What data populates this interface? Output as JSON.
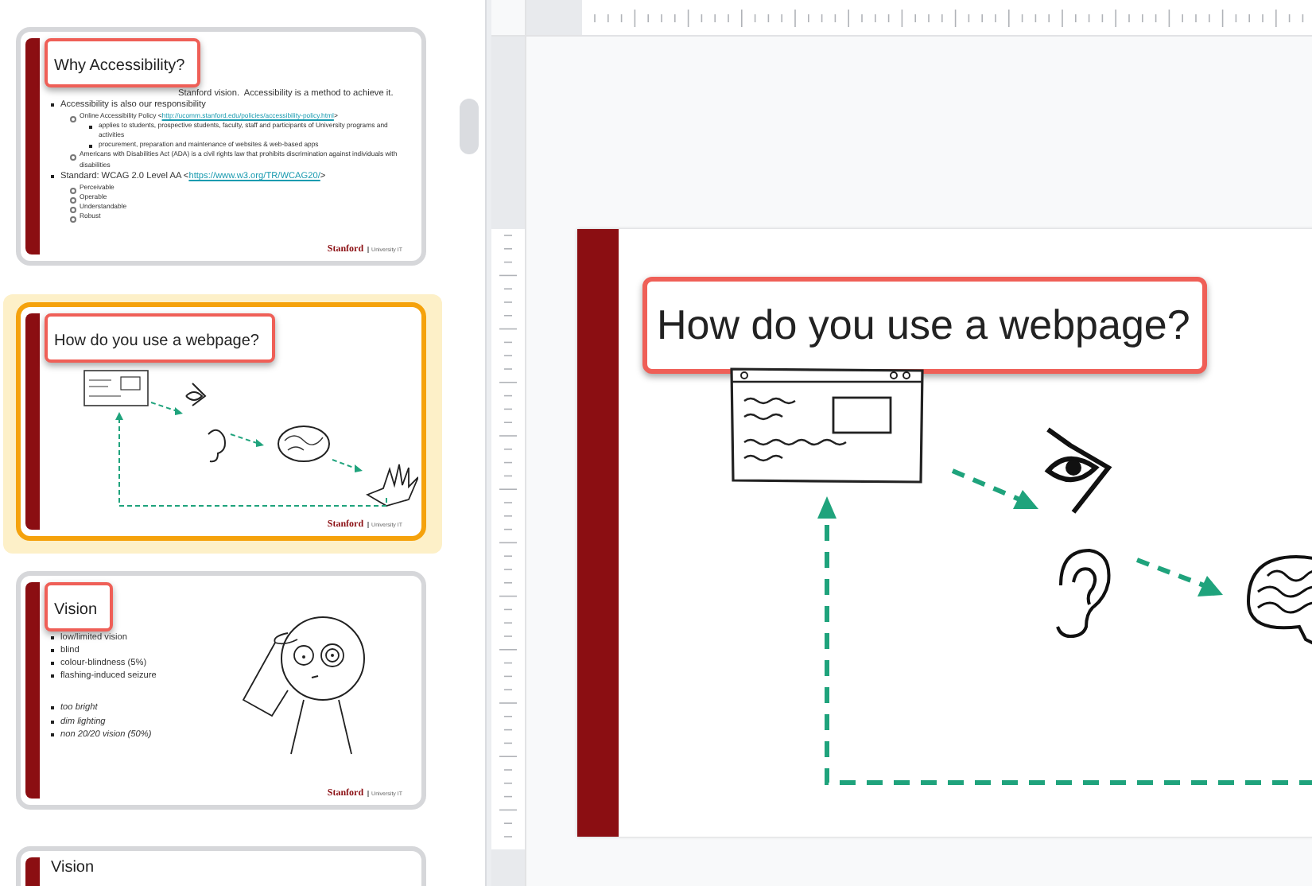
{
  "slides": [
    {
      "title": "Why Accessibility?",
      "selected": false,
      "highlighted": true,
      "lead": "Stanford vision.  Accessibility is a method to achieve it.",
      "bullets": [
        {
          "text": "Accessibility is also our responsibility",
          "children": [
            {
              "text": "Online Accessibility Policy <",
              "link": "http://ucomm.stanford.edu/policies/accessibility-policy.html",
              "after": ">",
              "children": [
                {
                  "text": "applies to students, prospective students, faculty, staff and participants of University programs and activities"
                },
                {
                  "text": "procurement, preparation and maintenance of websites & web-based apps"
                }
              ]
            },
            {
              "text": "Americans with Disabilities Act (ADA) is a civil rights law that prohibits discrimination against individuals with disabilities"
            }
          ]
        },
        {
          "text": "Standard: WCAG 2.0 Level AA <",
          "link": "https://www.w3.org/TR/WCAG20/",
          "after": ">",
          "children": [
            {
              "text": "Perceivable"
            },
            {
              "text": "Operable"
            },
            {
              "text": "Understandable"
            },
            {
              "text": "Robust"
            }
          ]
        }
      ],
      "footer": {
        "brand": "Stanford",
        "unit": "University IT"
      }
    },
    {
      "title": "How do you use a webpage?",
      "selected": true,
      "highlighted": true,
      "kind": "flow",
      "footer": {
        "brand": "Stanford",
        "unit": "University IT"
      }
    },
    {
      "title": "Vision",
      "selected": false,
      "highlighted": true,
      "kind": "person",
      "bullets": [
        {
          "text": "low/limited vision",
          "kind": "item"
        },
        {
          "text": "blind",
          "kind": "item"
        },
        {
          "text": "colour-blindness (5%)",
          "kind": "item"
        },
        {
          "text": "flashing-induced seizure",
          "kind": "item"
        },
        {
          "text": "too bright",
          "kind": "note"
        },
        {
          "text": "dim lighting",
          "kind": "note"
        },
        {
          "text": "non 20/20 vision (50%)",
          "kind": "note"
        }
      ],
      "footer": {
        "brand": "Stanford",
        "unit": "University IT"
      }
    },
    {
      "title": "Vision",
      "selected": false,
      "highlighted": false
    }
  ],
  "editor": {
    "title": "How do you use a webpage?",
    "highlighted": true,
    "kind": "flow"
  }
}
